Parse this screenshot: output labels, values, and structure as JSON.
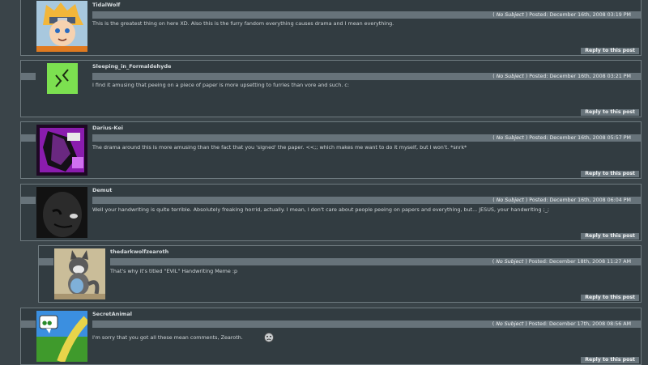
{
  "reply_label": "Reply to this post",
  "comments": [
    {
      "username": "TidalWolf",
      "no_subject": "No Subject",
      "posted": "Posted: December 16th, 2008 03:19 PM",
      "body": "This is the greatest thing on here XD. Also this is the furry fandom everything causes drama and I mean everything."
    },
    {
      "username": "Sleeping_in_Formaldehyde",
      "no_subject": "No Subject",
      "posted": "Posted: December 16th, 2008 03:21 PM",
      "body": "I find it amusing that peeing on a piece of paper is more upsetting to furries than vore and such. c:"
    },
    {
      "username": "Darius-Kei",
      "no_subject": "No Subject",
      "posted": "Posted: December 16th, 2008 05:57 PM",
      "body": "The drama around this is more amusing than the fact that you 'signed' the paper. <<;; which makes me want to do it myself, but I won't. *snrk*"
    },
    {
      "username": "Demut",
      "no_subject": "No Subject",
      "posted": "Posted: December 16th, 2008 06:04 PM",
      "body": "Well your handwriting is quite terrible. Absolutely freaking horrid, actually. I mean, I don't care about people peeing on papers and everything, but... JESUS, your handwriting ;_;"
    },
    {
      "username": "thedarkwolfzearoth",
      "no_subject": "No Subject",
      "posted": "Posted: December 18th, 2008 11:27 AM",
      "body": "That's why it's titled \"EVIL\" Handwriting Meme :p"
    },
    {
      "username": "SecretAnimal",
      "no_subject": "No Subject",
      "posted": "Posted: December 17th, 2008 08:56 AM",
      "body": "I'm sorry that you got all these mean comments, Zearoth."
    }
  ]
}
